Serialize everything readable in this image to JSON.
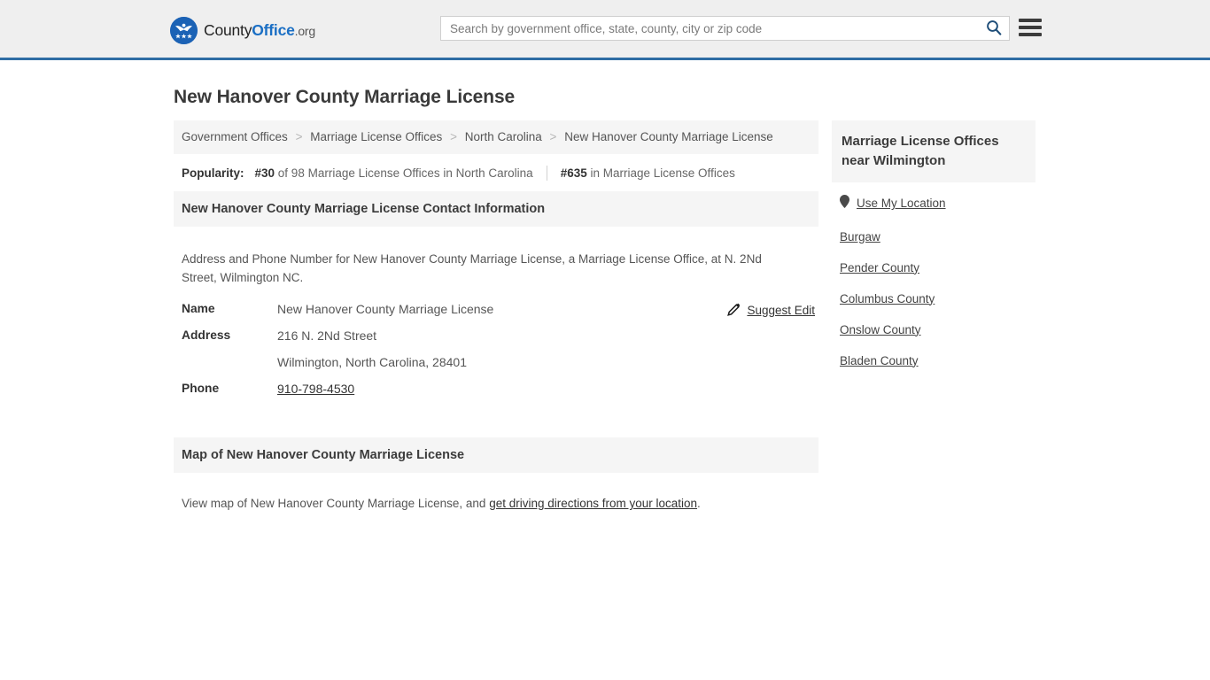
{
  "header": {
    "logo": {
      "icon": "eagle-seal-icon",
      "part1": "County",
      "part2": "Office",
      "part3": ".org"
    },
    "search": {
      "placeholder": "Search by government office, state, county, city or zip code",
      "value": "",
      "icon": "search-icon"
    },
    "menu": {
      "icon": "hamburger-menu-icon"
    },
    "accent_color": "#2e6da4",
    "background_color": "#efefef"
  },
  "page": {
    "title": "New Hanover County Marriage License"
  },
  "breadcrumb": {
    "separator": ">",
    "items": [
      {
        "label": "Government Offices",
        "link": true
      },
      {
        "label": "Marriage License Offices",
        "link": true
      },
      {
        "label": "North Carolina",
        "link": true
      },
      {
        "label": "New Hanover County Marriage License",
        "link": false
      }
    ]
  },
  "popularity": {
    "label": "Popularity:",
    "rank_state": "#30",
    "rank_state_text": " of 98 Marriage License Offices in North Carolina",
    "rank_overall": "#635",
    "rank_overall_text": " in Marriage License Offices"
  },
  "contact_section": {
    "heading": "New Hanover County Marriage License Contact Information",
    "description": "Address and Phone Number for New Hanover County Marriage License, a Marriage License Office, at N. 2Nd Street, Wilmington NC.",
    "rows": {
      "name_key": "Name",
      "name_value": "New Hanover County Marriage License",
      "address_key": "Address",
      "address_line1": "216 N. 2Nd Street",
      "address_line2": "Wilmington, North Carolina, 28401",
      "phone_key": "Phone",
      "phone_value": "910-798-4530"
    },
    "suggest_edit": {
      "label": "Suggest Edit",
      "icon": "edit-pencil-icon"
    }
  },
  "map_section": {
    "heading": "Map of New Hanover County Marriage License",
    "text_before": "View map of New Hanover County Marriage License, and ",
    "link": "get driving directions from your location",
    "text_after": "."
  },
  "sidebar": {
    "heading": "Marriage License Offices near Wilmington",
    "items": [
      {
        "label": "Use My Location",
        "icon": "location-pin-icon"
      },
      {
        "label": "Burgaw",
        "icon": ""
      },
      {
        "label": "Pender County",
        "icon": ""
      },
      {
        "label": "Columbus County",
        "icon": ""
      },
      {
        "label": "Onslow County",
        "icon": ""
      },
      {
        "label": "Bladen County",
        "icon": ""
      }
    ]
  }
}
